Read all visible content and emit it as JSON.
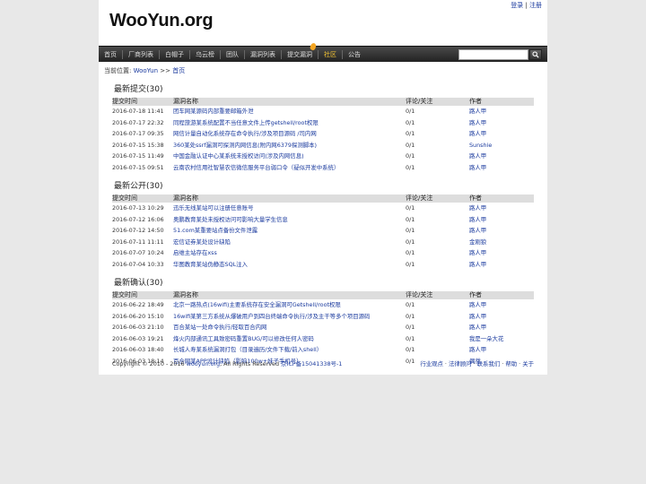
{
  "header": {
    "logo": "WooYun.org",
    "login": "登录",
    "sep": " | ",
    "register": "注册"
  },
  "nav": {
    "items": [
      "首页",
      "厂商列表",
      "白帽子",
      "乌云榜",
      "团队",
      "漏洞列表",
      "提交漏洞",
      "社区",
      "公告"
    ],
    "search_placeholder": "",
    "search_icon": "search-icon"
  },
  "breadcrumb": {
    "prefix": "当前位置:",
    "root": "WooYun",
    "arrow": " >> ",
    "current": "首页"
  },
  "columns": {
    "time": "提交时间",
    "name": "漏洞名称",
    "attention": "评论/关注",
    "author": "作者"
  },
  "sections": [
    {
      "title": "最新提交(30)",
      "rows": [
        {
          "time": "2016-07-18 11:41",
          "name": "团车网某源码内部重要邮箱外泄",
          "att": "0/1",
          "author": "路人甲"
        },
        {
          "time": "2016-07-17 22:32",
          "name": "同程旅游某系统配置不当任意文件上传getshell/root权限",
          "att": "0/1",
          "author": "路人甲"
        },
        {
          "time": "2016-07-17 09:35",
          "name": "网信计量自动化系统存在命令执行/涉及项目源码 /司内网",
          "att": "0/1",
          "author": "路人甲"
        },
        {
          "time": "2016-07-15 15:38",
          "name": "360某处ssrf漏洞可探测内网信息(附内网6379探测脚本)",
          "att": "0/1",
          "author": "Sunshie"
        },
        {
          "time": "2016-07-15 11:49",
          "name": "中国金融认证中心某系统未授权访问(涉及内网信息)",
          "att": "0/1",
          "author": "路人甲"
        },
        {
          "time": "2016-07-15 09:51",
          "name": "云南农村信用社智慧农信微信服务平台弱口令（疑似开发中系统）",
          "att": "0/1",
          "author": "路人甲"
        }
      ]
    },
    {
      "title": "最新公开(30)",
      "rows": [
        {
          "time": "2016-07-13 10:29",
          "name": "迅乐无线某站可以注册任意账号",
          "att": "0/1",
          "author": "路人甲"
        },
        {
          "time": "2016-07-12 16:06",
          "name": "奥鹏教育某处未授权访问可影响大量学生信息",
          "att": "0/1",
          "author": "路人甲"
        },
        {
          "time": "2016-07-12 14:50",
          "name": "51.com某重要站点备份文件泄露",
          "att": "0/1",
          "author": "路人甲"
        },
        {
          "time": "2016-07-11 11:11",
          "name": "宏信证券某处设计缺陷",
          "att": "0/1",
          "author": "金刚狼"
        },
        {
          "time": "2016-07-07 10:24",
          "name": "启维主站存在xss",
          "att": "0/1",
          "author": "路人甲"
        },
        {
          "time": "2016-07-04 10:33",
          "name": "华图教育某站伪静态SQL注入",
          "att": "0/1",
          "author": "路人甲"
        }
      ]
    },
    {
      "title": "最新确认(30)",
      "rows": [
        {
          "time": "2016-06-22 18:49",
          "name": "北京一路热点(16wifi)主要系统存在安全漏洞可Getshell/root权限",
          "att": "0/1",
          "author": "路人甲"
        },
        {
          "time": "2016-06-20 15:10",
          "name": "16wifi某第三方系统从爆破用户到四台终端命令执行/涉及主干等多个项目源码",
          "att": "0/1",
          "author": "路人甲"
        },
        {
          "time": "2016-06-03 21:10",
          "name": "百合某站一处命令执行/轻取百合内网",
          "att": "0/1",
          "author": "路人甲"
        },
        {
          "time": "2016-06-03 19:21",
          "name": "烽火内部通讯工具致密码重置BUG/可以修改任何人密码",
          "att": "0/1",
          "author": "我是一朵大花"
        },
        {
          "time": "2016-06-03 18:40",
          "name": "长城人寿某系统漏洞打包（目录遍历/文件下载/前入shell）",
          "att": "0/1",
          "author": "路人甲"
        },
        {
          "time": "2016-06-03 18:14",
          "name": "百合网某APP设计缺陷（影响100w+妹子手机号）",
          "att": "0/1",
          "author": "偶然"
        }
      ]
    }
  ],
  "footer": {
    "copyright_pre": "Copyright © 2010 - 2016 ",
    "site": "wooyun.org",
    "copyright_post": ", All Rights Reserved ",
    "icp": "京ICP备15041338号-1",
    "links": [
      "行业观点",
      "法律顾问",
      "联系我们",
      "帮助",
      "关于"
    ],
    "link_sep": " · "
  }
}
